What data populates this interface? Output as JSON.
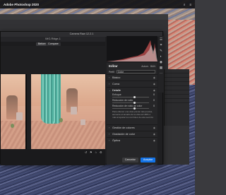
{
  "menubar": {
    "app_name": "Adobe Photoshop 2020",
    "items": [
      "",
      ""
    ],
    "status_time": ""
  },
  "photoshop": {
    "window_title": ""
  },
  "camera_raw": {
    "dialog_title": "Camera Raw 12.2.1",
    "file_name": "IMG-Ridge-1",
    "compare_tabs": [
      "Before",
      "Compare"
    ],
    "edit_panel": {
      "title": "Editar",
      "header_buttons": [
        "Autom.",
        "B&N"
      ],
      "profile_label": "Perfil",
      "profile_value": "Color",
      "sections": [
        {
          "label": "Básico",
          "open": false
        },
        {
          "label": "Curva",
          "open": false
        },
        {
          "label": "Detalle",
          "open": false
        },
        {
          "label": "Gestión de colores",
          "open": false
        },
        {
          "label": "Gradación de color",
          "open": false
        },
        {
          "label": "Óptica",
          "open": false
        }
      ],
      "open_section": {
        "label": "Detalle",
        "sliders": [
          {
            "label": "Enfoque",
            "value": "0",
            "level": 0.6
          },
          {
            "label": "Reducción de ruido",
            "value": "0",
            "level": 0.6
          },
          {
            "label": "Reducción de ruido de color",
            "value": "0",
            "level": 0.6
          }
        ],
        "description": "Para obtener una vista previa más precisa, aumente el tamaño de la vista al 100% o más al ajustar los controles de esta sección."
      },
      "cancel_label": "Cancelar",
      "ok_label": "Aceptar"
    },
    "toolstrip_icons": [
      "edit-icon",
      "crop-icon",
      "heal-icon",
      "mask-icon",
      "redeye-icon",
      "presets-icon",
      "more-icon"
    ],
    "status_icons": [
      "rotate-icon",
      "flag-icon",
      "star-icon",
      "settings-icon"
    ]
  }
}
